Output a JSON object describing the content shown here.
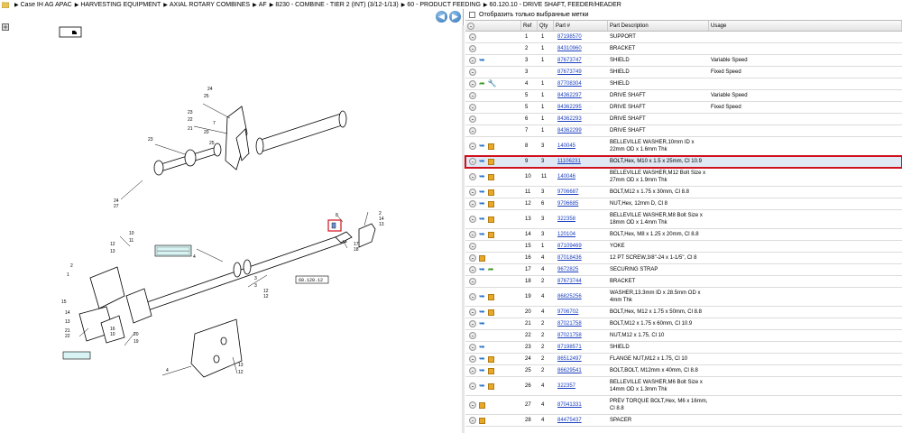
{
  "breadcrumb": [
    "Case IH AG APAC",
    "HARVESTING EQUIPMENT",
    "AXIAL ROTARY COMBINES",
    "AF",
    "8230 - COMBINE - TIER 2 (INT) (3/12-1/13)",
    "60 - PRODUCT FEEDING",
    "60.120.10 - DRIVE SHAFT, FEEDER/HEADER"
  ],
  "nav": {
    "back": "◀",
    "forward": "▶"
  },
  "filter": {
    "label": "Отобразить только выбранные метки"
  },
  "columns": {
    "ref": "Ref",
    "qty": "Qty",
    "part": "Part #",
    "desc": "Part Description",
    "usage": "Usage"
  },
  "diagram_callouts": {
    "left_box": "60.120.10",
    "left_box2": "60.120.10",
    "bottom_box": "60.120.12",
    "mid_box": "60.150.12"
  },
  "rows": [
    {
      "icons": [
        "circle"
      ],
      "ref": "1",
      "qty": "1",
      "part": "87198570",
      "desc": "SUPPORT",
      "usage": ""
    },
    {
      "icons": [
        "circle"
      ],
      "ref": "2",
      "qty": "1",
      "part": "84310960",
      "desc": "BRACKET",
      "usage": ""
    },
    {
      "icons": [
        "circle",
        "arrow"
      ],
      "ref": "3",
      "qty": "1",
      "part": "87673747",
      "desc": "SHIELD",
      "usage": "Variable Speed"
    },
    {
      "icons": [
        "circle"
      ],
      "ref": "3",
      "qty": "",
      "part": "87673749",
      "desc": "SHIELD",
      "usage": "Fixed Speed"
    },
    {
      "icons": [
        "circle",
        "green",
        "wrench"
      ],
      "ref": "4",
      "qty": "1",
      "part": "87708304",
      "desc": "SHIELD",
      "usage": ""
    },
    {
      "icons": [
        "circle"
      ],
      "ref": "5",
      "qty": "1",
      "part": "84362297",
      "desc": "DRIVE SHAFT",
      "usage": "Variable Speed"
    },
    {
      "icons": [
        "circle"
      ],
      "ref": "5",
      "qty": "1",
      "part": "84362295",
      "desc": "DRIVE SHAFT",
      "usage": "Fixed Speed"
    },
    {
      "icons": [
        "circle"
      ],
      "ref": "6",
      "qty": "1",
      "part": "84362293",
      "desc": "DRIVE SHAFT",
      "usage": ""
    },
    {
      "icons": [
        "circle"
      ],
      "ref": "7",
      "qty": "1",
      "part": "84362299",
      "desc": "DRIVE SHAFT",
      "usage": ""
    },
    {
      "icons": [
        "circle",
        "arrow",
        "box"
      ],
      "ref": "8",
      "qty": "3",
      "part": "140045",
      "desc": "BELLEVILLE WASHER,10mm ID x 22mm OD x 1.6mm Thk",
      "usage": ""
    },
    {
      "icons": [
        "circle",
        "arrow",
        "box"
      ],
      "ref": "9",
      "qty": "3",
      "part": "11106231",
      "desc": "BOLT,Hex, M10 x 1.5 x 25mm, Cl 10.9",
      "usage": "",
      "selected": true
    },
    {
      "icons": [
        "circle",
        "arrow",
        "box"
      ],
      "ref": "10",
      "qty": "11",
      "part": "140046",
      "desc": "BELLEVILLE WASHER,M12 Bolt Size x 27mm OD x 1.9mm Thk",
      "usage": ""
    },
    {
      "icons": [
        "circle",
        "arrow",
        "box"
      ],
      "ref": "11",
      "qty": "3",
      "part": "9706687",
      "desc": "BOLT,M12 x 1.75 x 30mm, Cl 8.8",
      "usage": ""
    },
    {
      "icons": [
        "circle",
        "arrow",
        "box"
      ],
      "ref": "12",
      "qty": "6",
      "part": "9706685",
      "desc": "NUT,Hex, 12mm D, Cl 8",
      "usage": ""
    },
    {
      "icons": [
        "circle",
        "arrow",
        "box"
      ],
      "ref": "13",
      "qty": "3",
      "part": "322358",
      "desc": "BELLEVILLE WASHER,M8 Bolt Size x 18mm OD x 1.4mm Thk",
      "usage": ""
    },
    {
      "icons": [
        "circle",
        "arrow",
        "box"
      ],
      "ref": "14",
      "qty": "3",
      "part": "120104",
      "desc": "BOLT,Hex, M8 x 1.25 x 20mm, Cl 8.8",
      "usage": ""
    },
    {
      "icons": [
        "circle"
      ],
      "ref": "15",
      "qty": "1",
      "part": "87109469",
      "desc": "YOKE",
      "usage": ""
    },
    {
      "icons": [
        "circle",
        "box"
      ],
      "ref": "16",
      "qty": "4",
      "part": "87018436",
      "desc": "12 PT SCREW,3/8\"-24 x 1-1/5\", Cl 8",
      "usage": ""
    },
    {
      "icons": [
        "circle",
        "arrow",
        "green"
      ],
      "ref": "17",
      "qty": "4",
      "part": "9672825",
      "desc": "SECURING STRAP",
      "usage": ""
    },
    {
      "icons": [
        "circle"
      ],
      "ref": "18",
      "qty": "2",
      "part": "87673744",
      "desc": "BRACKET",
      "usage": ""
    },
    {
      "icons": [
        "circle",
        "arrow",
        "box"
      ],
      "ref": "19",
      "qty": "4",
      "part": "86825256",
      "desc": "WASHER,13.3mm ID x 28.5mm OD x 4mm Thk",
      "usage": ""
    },
    {
      "icons": [
        "circle",
        "arrow",
        "box"
      ],
      "ref": "20",
      "qty": "4",
      "part": "9706702",
      "desc": "BOLT,Hex, M12 x 1.75 x 50mm, Cl 8.8",
      "usage": ""
    },
    {
      "icons": [
        "circle",
        "arrow"
      ],
      "ref": "21",
      "qty": "2",
      "part": "87021758",
      "desc": "BOLT,M12 x 1.75 x 60mm, Cl 10.9",
      "usage": ""
    },
    {
      "icons": [
        "circle"
      ],
      "ref": "22",
      "qty": "2",
      "part": "87021758",
      "desc": "NUT,M12 x 1.75, Cl 10",
      "usage": ""
    },
    {
      "icons": [
        "circle",
        "arrow"
      ],
      "ref": "23",
      "qty": "2",
      "part": "87198571",
      "desc": "SHIELD",
      "usage": ""
    },
    {
      "icons": [
        "circle",
        "arrow",
        "box"
      ],
      "ref": "24",
      "qty": "2",
      "part": "86512497",
      "desc": "FLANGE NUT,M12 x 1.75, Cl 10",
      "usage": ""
    },
    {
      "icons": [
        "circle",
        "arrow",
        "box"
      ],
      "ref": "25",
      "qty": "2",
      "part": "86629541",
      "desc": "BOLT,BOLT, M12mm x 40mm, Cl 8.8",
      "usage": ""
    },
    {
      "icons": [
        "circle",
        "arrow",
        "box"
      ],
      "ref": "26",
      "qty": "4",
      "part": "322357",
      "desc": "BELLEVILLE WASHER,M6 Bolt Size x 14mm OD x 1.3mm Thk",
      "usage": ""
    },
    {
      "icons": [
        "circle",
        "box"
      ],
      "ref": "27",
      "qty": "4",
      "part": "87041331",
      "desc": "PREV TORQUE BOLT,Hex, M6 x 16mm, Cl 8.8",
      "usage": ""
    },
    {
      "icons": [
        "circle",
        "box"
      ],
      "ref": "28",
      "qty": "4",
      "part": "84475437",
      "desc": "SPACER",
      "usage": ""
    }
  ]
}
